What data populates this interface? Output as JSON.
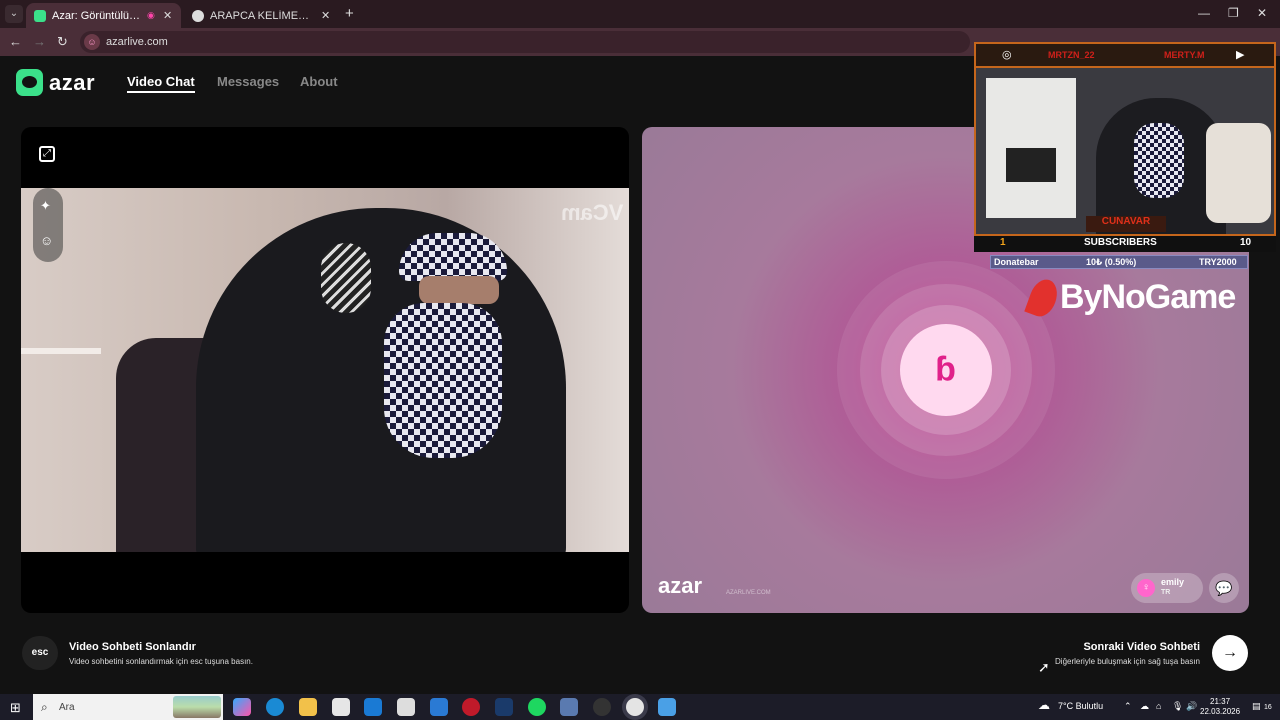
{
  "browser": {
    "tabs": [
      {
        "title": "Azar: Görüntülü Sohbet & V",
        "active": true
      },
      {
        "title": "ARAPCA KELİMELER OKUNUSL",
        "active": false
      }
    ],
    "url": "azarlive.com"
  },
  "page": {
    "logo_text": "azar",
    "nav": [
      {
        "label": "Video Chat",
        "active": true
      },
      {
        "label": "Messages",
        "active": false
      },
      {
        "label": "About",
        "active": false
      }
    ],
    "local_video": {
      "watermark": "VCam"
    },
    "remote": {
      "logo_text": "azar",
      "logo_sub": "AZARLIVE.COM",
      "partner_name": "emily",
      "partner_country": "TR"
    },
    "footer": {
      "esc_label": "esc",
      "end_title": "Video Sohbeti Sonlandır",
      "end_subtitle": "Video sohbetini sonlandırmak için esc tuşuna basın.",
      "next_title": "Sonraki Video Sohbeti",
      "next_subtitle": "Diğerleriyle buluşmak için sağ tuşa basın"
    }
  },
  "stream_overlay": {
    "instagram_handle": "MRTZN_22",
    "youtube_handle": "MERTY.M",
    "streamer_name": "CUNAVAR",
    "subs_left": "1",
    "subs_label": "SUBSCRIBERS",
    "subs_right": "10",
    "donate_label": "Donatebar",
    "donate_progress": "10₺ (0.50%)",
    "donate_goal": "TRY2000",
    "sponsor": "ByNoGame"
  },
  "taskbar": {
    "search_placeholder": "Ara",
    "weather": "7°C  Bulutlu",
    "time": "21:37",
    "date": "22.03.2026",
    "notif_count": "16"
  }
}
